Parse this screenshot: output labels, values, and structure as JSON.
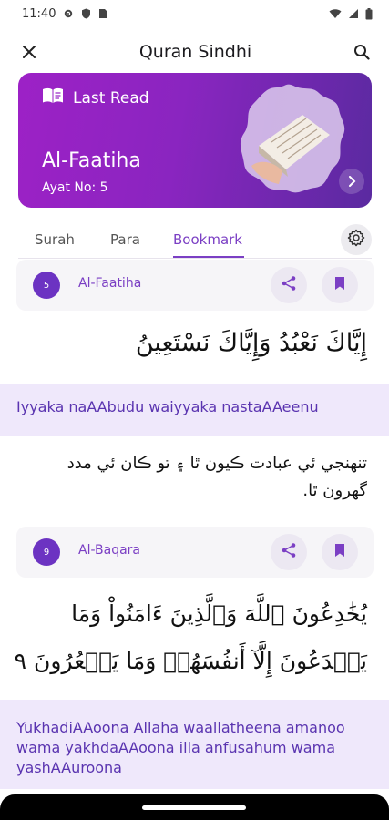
{
  "status_bar": {
    "time": "11:40"
  },
  "app_bar": {
    "title": "Quran Sindhi"
  },
  "last_read": {
    "label": "Last Read",
    "surah": "Al-Faatiha",
    "ayat": "Ayat No: 5"
  },
  "tabs": [
    {
      "label": "Surah",
      "active": false
    },
    {
      "label": "Para",
      "active": false
    },
    {
      "label": "Bookmark",
      "active": true
    }
  ],
  "bookmarks": [
    {
      "number": "5",
      "surah": "Al-Faatiha",
      "arabic": "إِيَّاكَ نَعْبُدُ وَإِيَّاكَ نَسْتَعِينُ",
      "transliteration": "Iyyaka naAAbudu waiyyaka nastaAAeenu",
      "sindhi": "تنهنجي ئي عبادت ڪيون ٿا ۽ تو ڪان ئي مدد گھرون ٿا."
    },
    {
      "number": "9",
      "surah": "Al-Baqara",
      "arabic": "يُخَٰدِعُونَ ٱللَّهَ وَٱلَّذِينَ ءَامَنُواْ وَمَا يَخۡدَعُونَ إِلَّآ أَنفُسَهُمۡ وَمَا يَشۡعُرُونَ ٩",
      "transliteration": "YukhadiAAoona Allaha waallatheena amanoo wama yakhdaAAoona illa anfusahum wama yashAAuroona"
    }
  ],
  "colors": {
    "accent": "#7b3fc4",
    "card_start": "#9d21c6",
    "card_end": "#5a2aa0",
    "translit_bg": "#efe8fb"
  }
}
